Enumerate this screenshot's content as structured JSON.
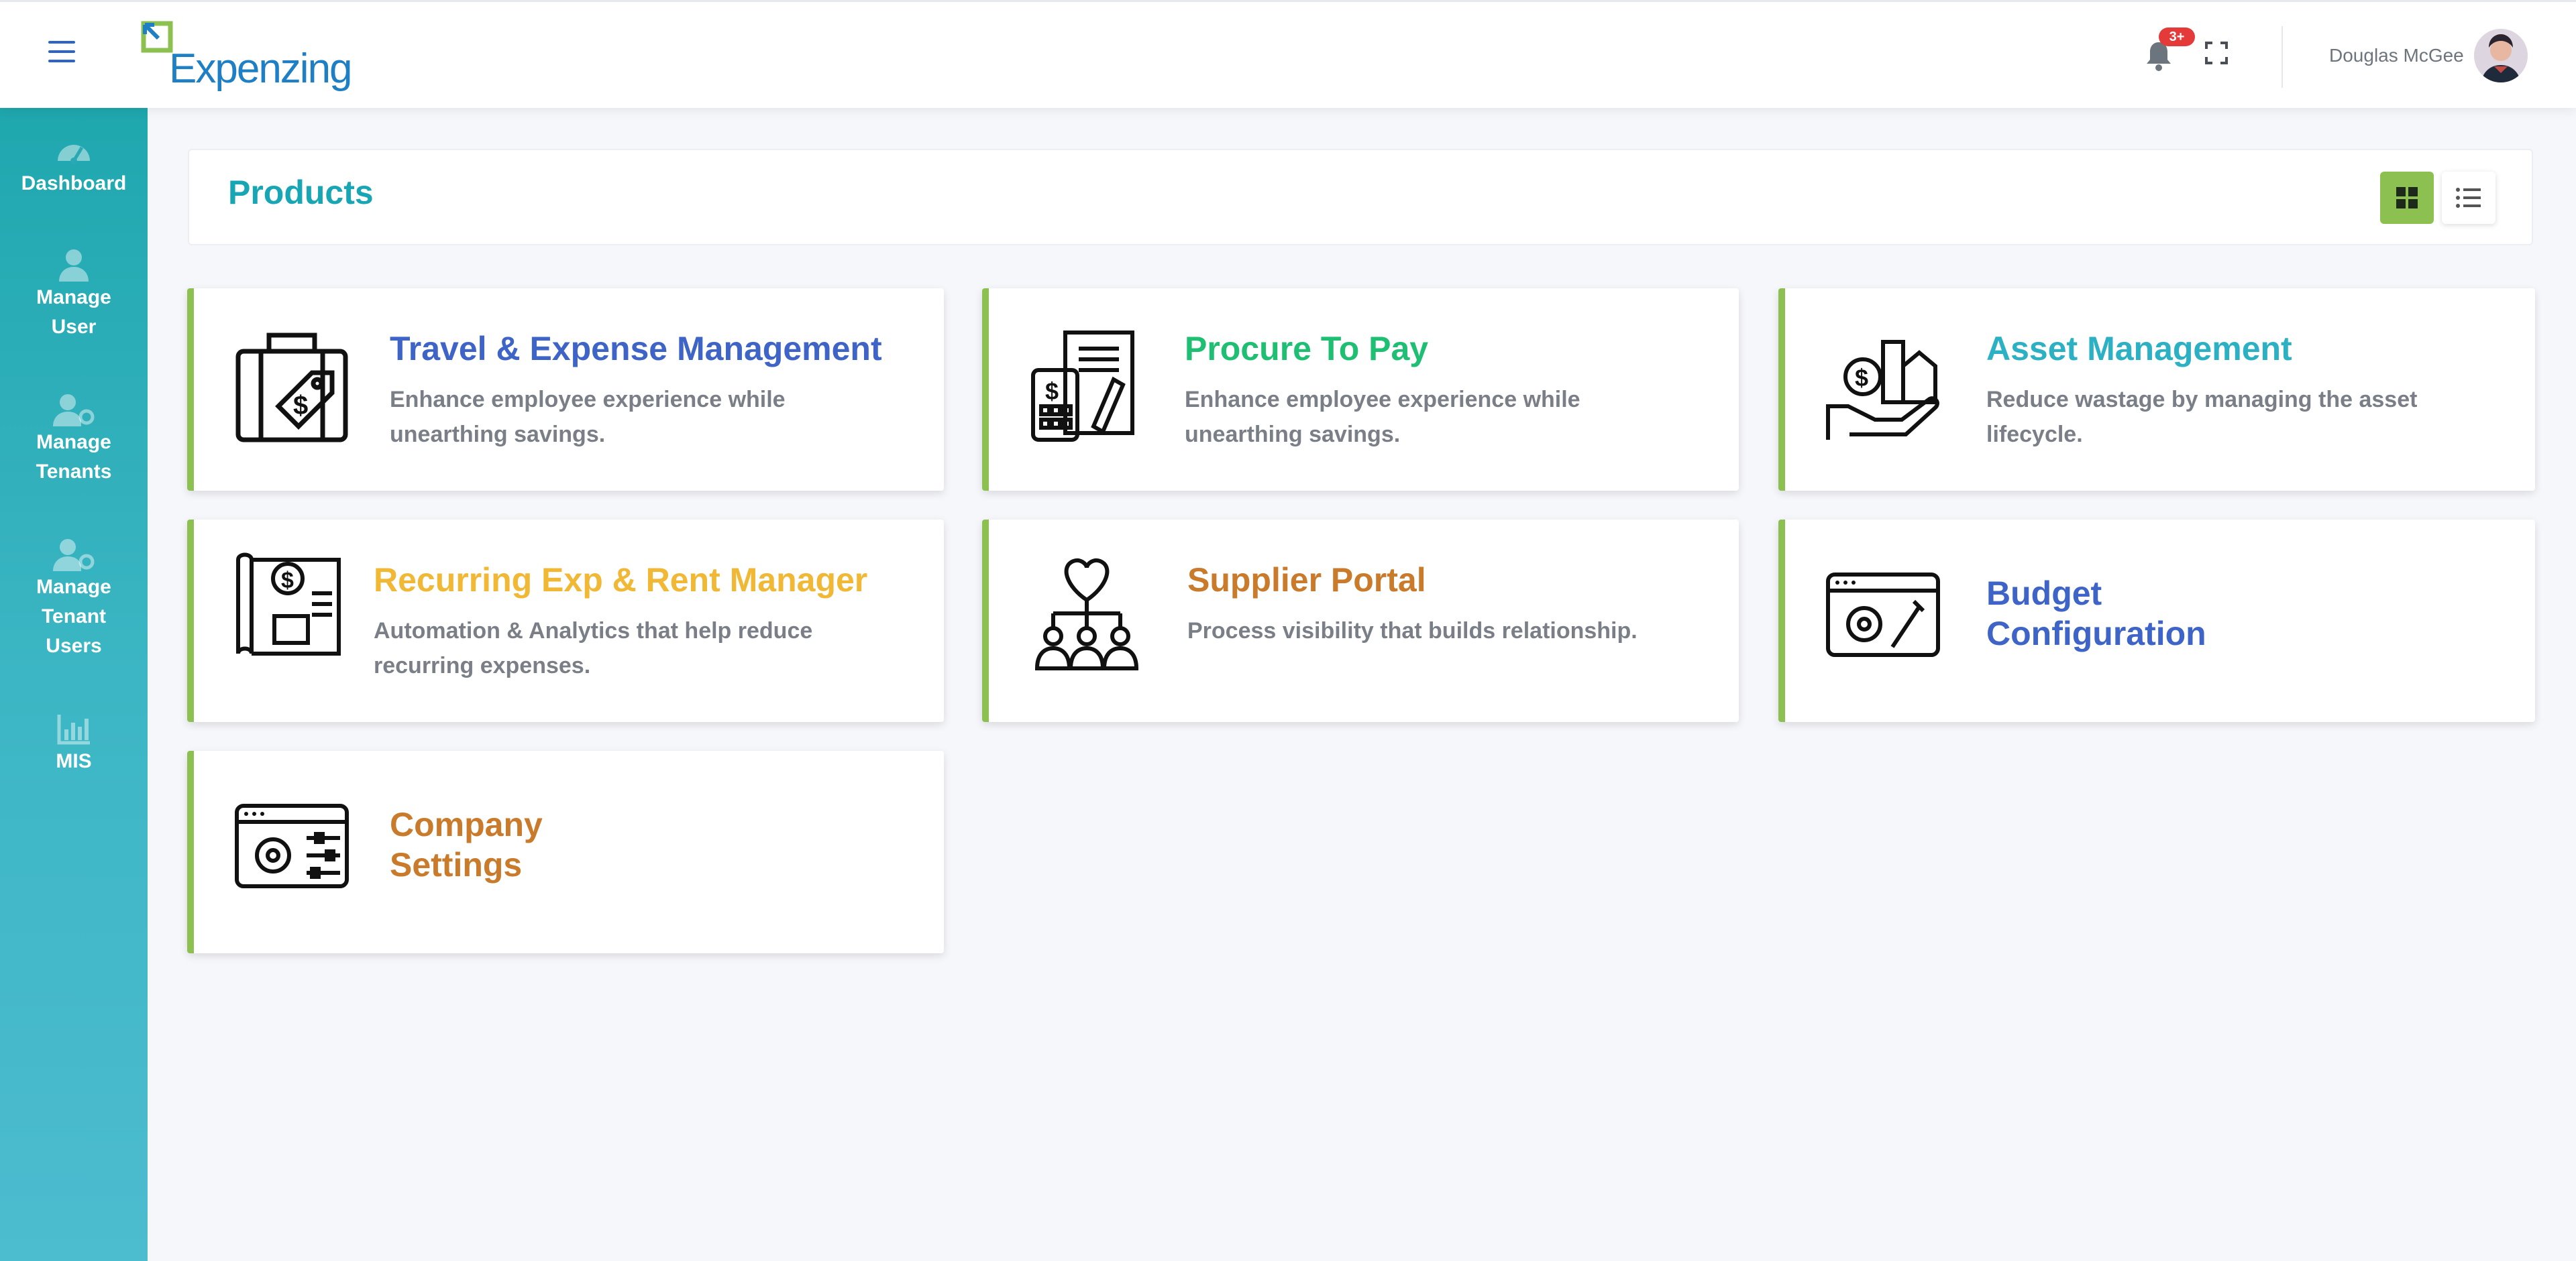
{
  "header": {
    "logo_text": "Expenzing",
    "notification_badge": "3+",
    "user_name": "Douglas McGee",
    "icons": [
      "hamburger-icon",
      "bell-icon",
      "fullscreen-icon"
    ]
  },
  "sidebar": {
    "items": [
      {
        "label": "Dashboard",
        "icon": "speedometer-icon"
      },
      {
        "label": "Manage User",
        "icon": "user-icon"
      },
      {
        "label": "Manage Tenants",
        "icon": "user-gear-icon"
      },
      {
        "label": "Manage Tenant Users",
        "icon": "user-gear-icon"
      },
      {
        "label": "MIS",
        "icon": "bar-chart-icon"
      }
    ]
  },
  "products": {
    "title": "Products",
    "view_modes": [
      "grid",
      "list"
    ],
    "cards": [
      {
        "title": "Travel & Expense Management",
        "desc": "Enhance employee experience while unearthing savings.",
        "color": "#3f64c8",
        "icon": "luggage-dollar-tag-icon"
      },
      {
        "title": "Procure To Pay",
        "desc": "Enhance employee experience while unearthing savings.",
        "color": "#1fbf73",
        "icon": "invoice-calculator-icon"
      },
      {
        "title": "Asset Management",
        "desc": "Reduce wastage by managing the asset lifecycle.",
        "color": "#2bb0c4",
        "icon": "hand-assets-icon"
      },
      {
        "title": "Recurring Exp & Rent Manager",
        "desc": "Automation & Analytics that help reduce recurring expenses.",
        "color": "#f0b834",
        "icon": "blueprint-dollar-icon"
      },
      {
        "title": "Supplier Portal",
        "desc": "Process visibility that builds relationship.",
        "color": "#c97a2a",
        "icon": "handshake-network-icon"
      },
      {
        "title": "Budget Configuration",
        "desc": "",
        "color": "#3f64c8",
        "icon": "browser-gear-wrench-icon"
      },
      {
        "title": "Company Settings",
        "desc": "",
        "color": "#c97a2a",
        "icon": "browser-gear-sliders-icon"
      }
    ]
  },
  "colors": {
    "accent_green": "#8cc152",
    "sidebar_teal": "#1fa7ae",
    "title_teal": "#18a6b4",
    "badge_red": "#e43a3a"
  }
}
